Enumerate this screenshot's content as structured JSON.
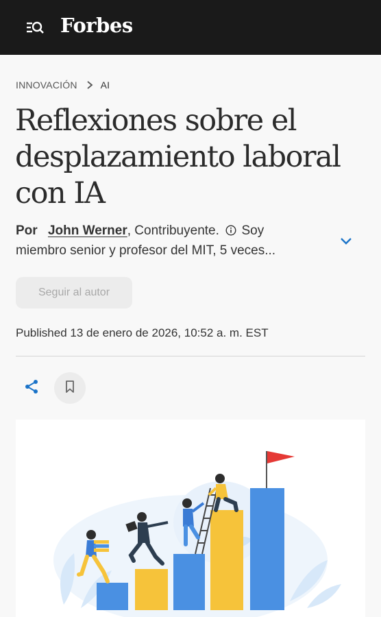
{
  "header": {
    "logo": "Forbes",
    "menu_icon": "menu-search-icon"
  },
  "breadcrumb": {
    "section": "INNOVACIÓN",
    "subsection": "AI"
  },
  "article": {
    "title": "Reflexiones sobre el desplazamiento laboral con IA",
    "by_label": "Por",
    "author": "John Werner",
    "role": ", Contribuyente.",
    "bio": " Soy miembro senior y profesor del MIT, 5 veces...",
    "follow_label": "Seguir al autor",
    "published": "Published 13 de enero de 2026, 10:52 a. m. EST"
  },
  "actions": {
    "share_icon": "share-icon",
    "bookmark_icon": "bookmark-icon"
  },
  "colors": {
    "topbar": "#1a1a1a",
    "accent_blue": "#1a73c8",
    "bar_blue": "#4a90e2",
    "bar_yellow": "#f6c33a",
    "flag_red": "#e53935"
  }
}
